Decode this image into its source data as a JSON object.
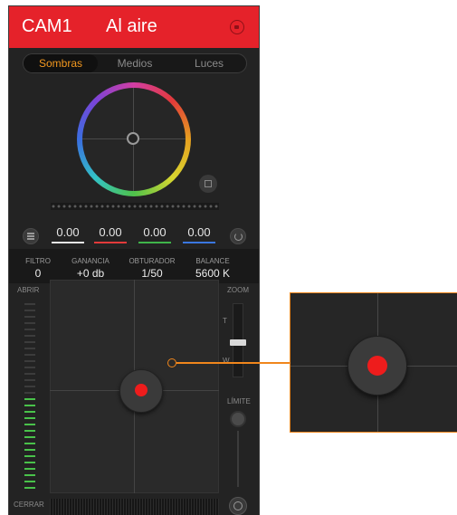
{
  "header": {
    "camera": "CAM1",
    "status": "Al aire",
    "lock_icon": "lock-icon"
  },
  "tabs": [
    {
      "label": "Sombras",
      "active": true
    },
    {
      "label": "Medios",
      "active": false
    },
    {
      "label": "Luces",
      "active": false
    }
  ],
  "color_values": [
    {
      "value": "0.00",
      "color": "#e6e6e6"
    },
    {
      "value": "0.00",
      "color": "#e23a3a"
    },
    {
      "value": "0.00",
      "color": "#3fb54a"
    },
    {
      "value": "0.00",
      "color": "#3a77e0"
    }
  ],
  "settings": [
    {
      "label": "FILTRO",
      "value": "0"
    },
    {
      "label": "GANANCIA",
      "value": "+0 db"
    },
    {
      "label": "OBTURADOR",
      "value": "1/50"
    },
    {
      "label": "BALANCE",
      "value": "5600 K"
    }
  ],
  "iris": {
    "open_label": "ABRIR",
    "close_label": "CERRAR"
  },
  "zoom": {
    "label": "ZOOM",
    "tele": "T",
    "wide": "W"
  },
  "limit": {
    "label": "LÍMITE"
  },
  "colors": {
    "on_air": "#e5222a",
    "active_tab": "#f3981f",
    "meter_on": "#49c24a",
    "callout": "#f0861c"
  }
}
